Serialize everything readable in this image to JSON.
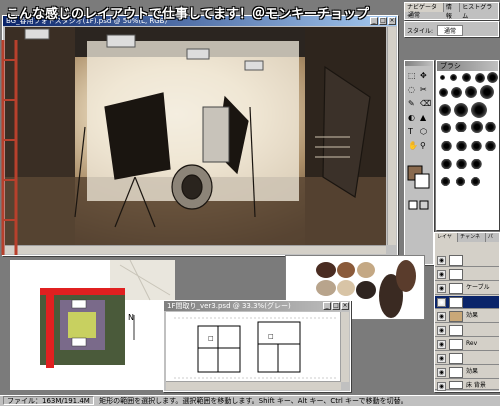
{
  "banner": {
    "text": "こんな感じのレイアウトで仕事してます！＠モンキーチョップ"
  },
  "main_window": {
    "title": "BG_春用フォトスタジオ(1F).psd @ 50%(L, RGB)"
  },
  "navigator": {
    "title": "ナビゲーター",
    "tab2": "情報",
    "tab3": "ヒストグラム",
    "field_label": "通常"
  },
  "tool_options": {
    "label": "スタイル:",
    "value": "通常"
  },
  "brushes": {
    "title": "ブラシ"
  },
  "layers_panel": {
    "title": "レイヤー",
    "tab2": "チャンネル",
    "tab3": "パス",
    "rows": [
      {
        "name": ""
      },
      {
        "name": ""
      },
      {
        "name": "ケーブル"
      },
      {
        "name": ""
      },
      {
        "name": "効果"
      },
      {
        "name": ""
      },
      {
        "name": "Rev"
      },
      {
        "name": ""
      },
      {
        "name": "効果"
      },
      {
        "name": "床 背景"
      }
    ]
  },
  "floor_plan_window": {
    "title": "1F間取り_ver3.psd @ 33.3%(グレー)"
  },
  "status_bar": {
    "zoom": "ファイル：163M/191.4M",
    "hint": "矩形の範囲を選択します。選択範囲を移動します。Shift キー、Alt キー、Ctrl キーで移動を切替。"
  },
  "colors": {
    "accent": "#0a246a",
    "swatch_brown": "#8a6a4e"
  }
}
